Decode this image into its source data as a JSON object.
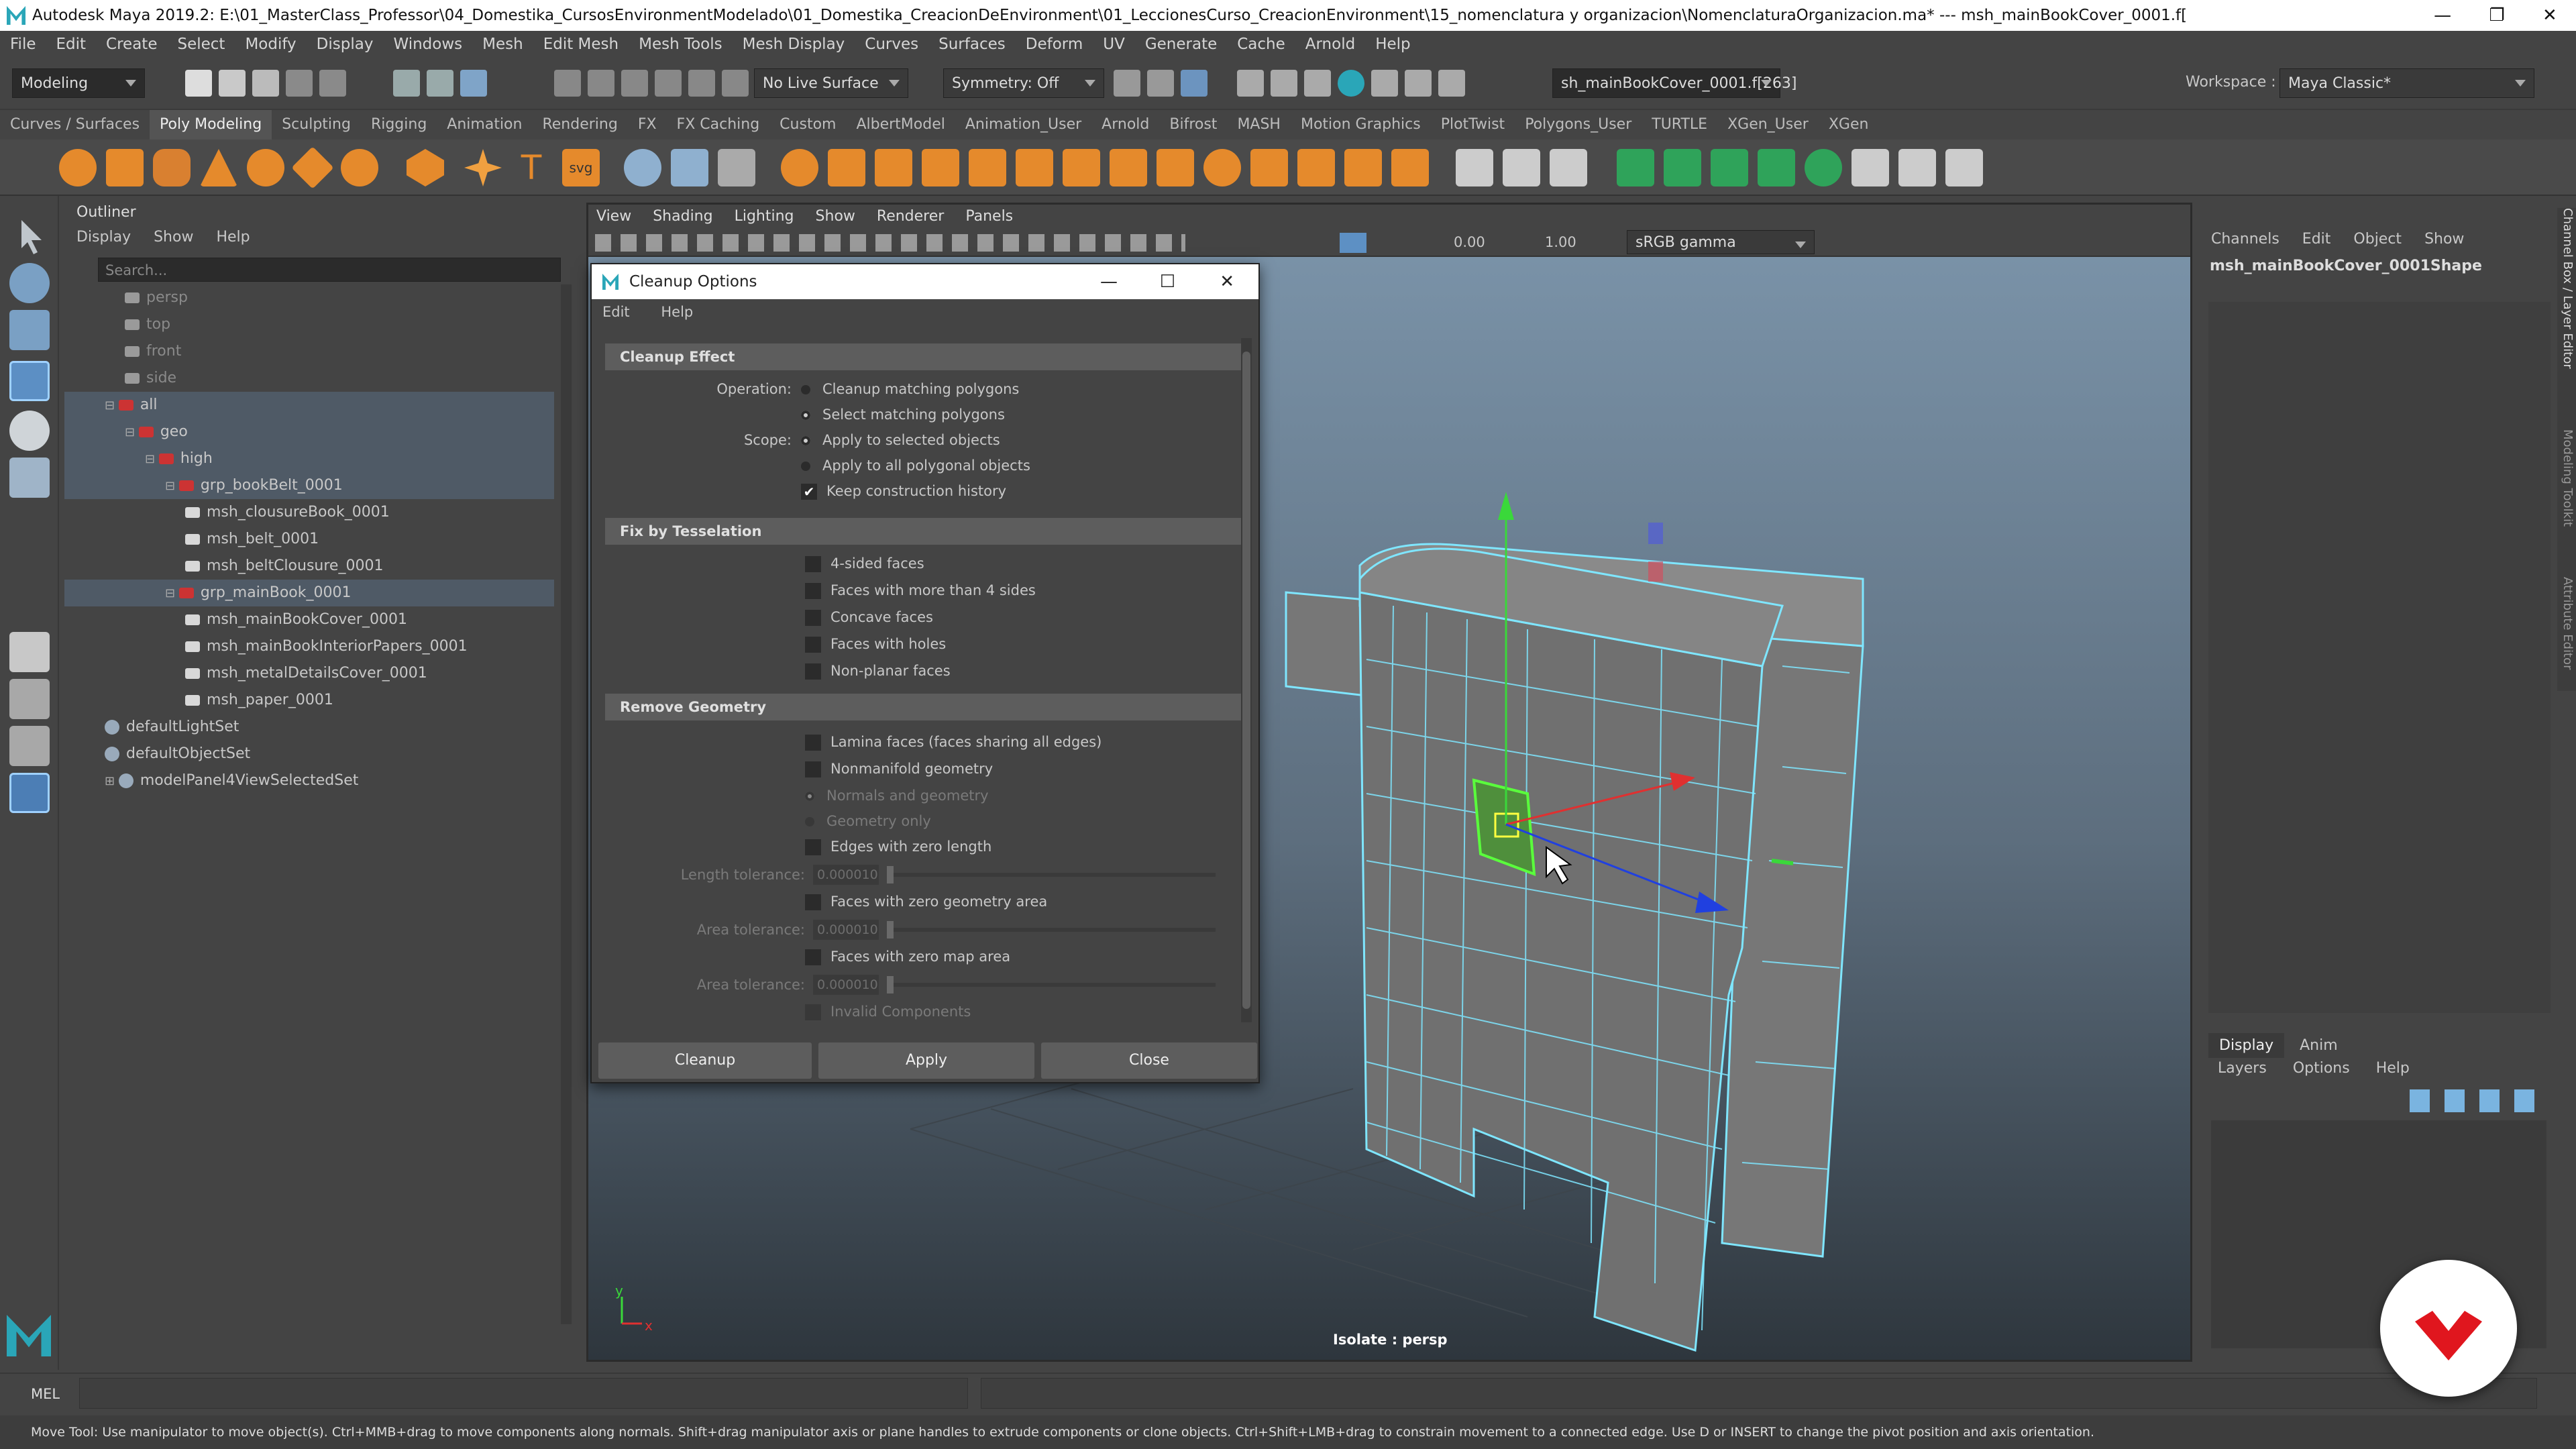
{
  "window": {
    "title": "Autodesk Maya 2019.2: E:\\01_MasterClass_Professor\\04_Domestika_CursosEnvironmentModelado\\01_Domestika_CreacionDeEnvironment\\01_LeccionesCurso_CreacionEnvironment\\15_nomenclatura y organizacion\\NomenclaturaOrganizacion.ma* --- msh_mainBookCover_0001.f[",
    "minimize": "—",
    "maximize": "❐",
    "close": "✕"
  },
  "menubar": [
    "File",
    "Edit",
    "Create",
    "Select",
    "Modify",
    "Display",
    "Windows",
    "Mesh",
    "Edit Mesh",
    "Mesh Tools",
    "Mesh Display",
    "Curves",
    "Surfaces",
    "Deform",
    "UV",
    "Generate",
    "Cache",
    "Arnold",
    "Help"
  ],
  "statusline": {
    "mode": "Modeling",
    "live_surface": "No Live Surface",
    "symmetry": "Symmetry: Off",
    "selection_field": "sh_mainBookCover_0001.f[263]",
    "workspace_label": "Workspace :",
    "workspace": "Maya Classic*"
  },
  "shelf_tabs": [
    "Curves / Surfaces",
    "Poly Modeling",
    "Sculpting",
    "Rigging",
    "Animation",
    "Rendering",
    "FX",
    "FX Caching",
    "Custom",
    "AlbertModel",
    "Animation_User",
    "Arnold",
    "Bifrost",
    "MASH",
    "Motion Graphics",
    "PlotTwist",
    "Polygons_User",
    "TURTLE",
    "XGen_User",
    "XGen"
  ],
  "shelf_active": "Poly Modeling",
  "outliner": {
    "title": "Outliner",
    "menu": [
      "Display",
      "Show",
      "Help"
    ],
    "search_placeholder": "Search...",
    "items": [
      {
        "label": "persp",
        "type": "camera"
      },
      {
        "label": "top",
        "type": "camera"
      },
      {
        "label": "front",
        "type": "camera"
      },
      {
        "label": "side",
        "type": "camera"
      },
      {
        "label": "all",
        "type": "group"
      },
      {
        "label": "geo",
        "type": "group"
      },
      {
        "label": "high",
        "type": "group"
      },
      {
        "label": "grp_bookBelt_0001",
        "type": "group"
      },
      {
        "label": "msh_clousureBook_0001",
        "type": "mesh"
      },
      {
        "label": "msh_belt_0001",
        "type": "mesh"
      },
      {
        "label": "msh_beltClousure_0001",
        "type": "mesh"
      },
      {
        "label": "grp_mainBook_0001",
        "type": "group"
      },
      {
        "label": "msh_mainBookCover_0001",
        "type": "mesh"
      },
      {
        "label": "msh_mainBookInteriorPapers_0001",
        "type": "mesh"
      },
      {
        "label": "msh_metalDetailsCover_0001",
        "type": "mesh"
      },
      {
        "label": "msh_paper_0001",
        "type": "mesh"
      },
      {
        "label": "defaultLightSet",
        "type": "set"
      },
      {
        "label": "defaultObjectSet",
        "type": "set"
      },
      {
        "label": "modelPanel4ViewSelectedSet",
        "type": "set"
      }
    ]
  },
  "viewport": {
    "menu": [
      "View",
      "Shading",
      "Lighting",
      "Show",
      "Renderer",
      "Panels"
    ],
    "near_value": "0.00",
    "far_value": "1.00",
    "color_space": "sRGB gamma",
    "camera_label": "Isolate : persp",
    "axis_y": "y",
    "axis_x": "x"
  },
  "dialog": {
    "title": "Cleanup Options",
    "menu": [
      "Edit",
      "Help"
    ],
    "section1": "Cleanup Effect",
    "operation_label": "Operation:",
    "op1": "Cleanup matching polygons",
    "op2": "Select matching polygons",
    "scope_label": "Scope:",
    "scope1": "Apply to selected objects",
    "scope2": "Apply to all polygonal objects",
    "keep_history": "Keep construction history",
    "section2": "Fix by Tesselation",
    "tess": [
      "4-sided faces",
      "Faces with more than 4 sides",
      "Concave faces",
      "Faces with holes",
      "Non-planar faces"
    ],
    "section3": "Remove Geometry",
    "lamina": "Lamina faces (faces sharing all edges)",
    "nonmanifold": "Nonmanifold geometry",
    "normals_geometry": "Normals and geometry",
    "geometry_only": "Geometry only",
    "zero_length": "Edges with zero length",
    "length_tol_label": "Length tolerance:",
    "tol_value": "0.000010",
    "zero_area": "Faces with zero geometry area",
    "area_tol_label": "Area tolerance:",
    "zero_map": "Faces with zero map area",
    "invalid": "Invalid Components",
    "btn_cleanup": "Cleanup",
    "btn_apply": "Apply",
    "btn_close": "Close"
  },
  "channelbox": {
    "menu": [
      "Channels",
      "Edit",
      "Object",
      "Show"
    ],
    "shape": "msh_mainBookCover_0001Shape",
    "side_tabs": [
      "Channel Box / Layer Editor",
      "Modeling Toolkit",
      "Attribute Editor"
    ]
  },
  "layers": {
    "tabs": [
      "Display",
      "Anim"
    ],
    "menu": [
      "Layers",
      "Options",
      "Help"
    ]
  },
  "cmdline": {
    "label": "MEL"
  },
  "helpline": "Move Tool: Use manipulator to move object(s). Ctrl+MMB+drag to move components along normals. Shift+drag manipulator axis or plane handles to extrude components or clone objects. Ctrl+Shift+LMB+drag to constrain movement to a connected edge. Use D or INSERT to change the pivot position and axis orientation.",
  "colors": {
    "accent": "#2aa6b8",
    "selection": "#4f5a66",
    "wire": "#7fe6ff",
    "brand": "#e0161e"
  }
}
